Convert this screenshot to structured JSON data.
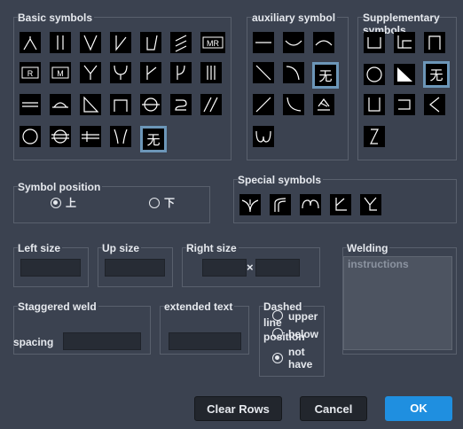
{
  "basic": {
    "title": "Basic symbols"
  },
  "aux": {
    "title": "auxiliary symbol"
  },
  "supp": {
    "title": "Supplementary symbols"
  },
  "position": {
    "title": "Symbol position",
    "options": [
      "上",
      "下"
    ],
    "selected": "上"
  },
  "special": {
    "title": "Special symbols"
  },
  "sizes": {
    "left": "Left size",
    "up": "Up size",
    "right": "Right size",
    "times": "×"
  },
  "welding": {
    "title": "Welding",
    "placeholder": "instructions"
  },
  "staggered": {
    "title": "Staggered weld",
    "spacing": "spacing"
  },
  "extended": {
    "title": "extended text"
  },
  "dashed": {
    "title_line1": "Dashed",
    "title_line2": "line",
    "title_line3": "position",
    "options": [
      "upper",
      "below",
      "not have"
    ],
    "selected": "not have"
  },
  "buttons": {
    "clear": "Clear Rows",
    "cancel": "Cancel",
    "ok": "OK"
  },
  "colors": {
    "bg": "#3b4250",
    "accent": "#1f8fe0",
    "selected_outline": "#6c96b8"
  },
  "icons": {
    "basic_row1": [
      "fillet-open-icon",
      "double-bar-icon",
      "v-groove-icon",
      "bevel-icon",
      "bevel-u-icon",
      "double-slash-icon",
      "mr-box-icon"
    ],
    "basic_row2": [
      "r-box-icon",
      "m-box-icon",
      "y-groove-icon",
      "u-groove-icon",
      "j-groove-icon",
      "single-j-icon",
      "triple-bar-icon"
    ],
    "basic_row3": [
      "double-line-icon",
      "half-circle-icon",
      "fillet-triangle-icon",
      "square-corner-icon",
      "circle-line-icon",
      "s-curve-icon",
      "double-diagonal-icon"
    ],
    "basic_row4": [
      "circle-icon",
      "circle-double-line-icon",
      "strike-double-line-icon",
      "flare-v-icon",
      "none-kanji-icon"
    ],
    "aux": [
      "flat-line-icon",
      "concave-icon",
      "convex-icon",
      "diagonal-line-icon",
      "curve-corner-icon",
      "none-kanji-icon",
      "rising-line-icon",
      "curve-down-icon",
      "caret-underline-icon",
      "ground-hook-icon"
    ],
    "supp": [
      "open-box-left-icon",
      "corner-box-icon",
      "gate-icon",
      "open-circle-icon",
      "filled-triangle-icon",
      "none-kanji-icon",
      "u-channel-icon",
      "bracket-right-icon",
      "less-than-icon",
      "z-stroke-icon"
    ],
    "special": [
      "arc-legs-icon",
      "curve-legs-icon",
      "wave-arc-icon",
      "k-symbol-icon",
      "k-v-symbol-icon"
    ]
  }
}
